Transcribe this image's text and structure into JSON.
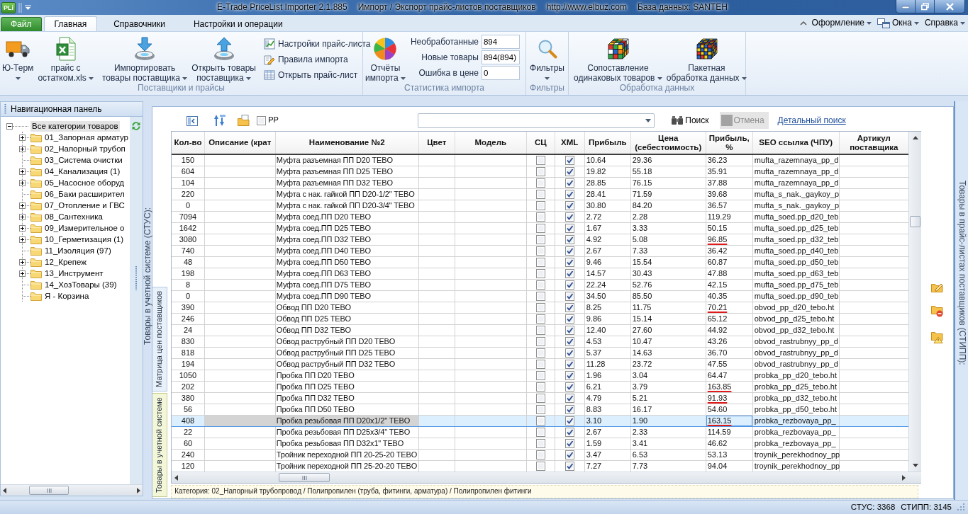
{
  "window": {
    "app_icon_label": "PLi",
    "title_parts": [
      "E-Trade PriceList Importer 2.1.885",
      "Импорт / Экспорт прайс-листов поставщиков",
      "http://www.elbuz.com",
      "База данных: SANTEH"
    ]
  },
  "ribbon": {
    "tabs": [
      {
        "label": "Файл",
        "kind": "file",
        "selected": false
      },
      {
        "label": "Главная",
        "kind": "tab",
        "selected": true
      },
      {
        "label": "Справочники",
        "kind": "tab",
        "selected": false
      },
      {
        "label": "Настройки и операции",
        "kind": "tab",
        "selected": false
      }
    ],
    "menus": [
      {
        "label": "Оформление"
      },
      {
        "label": "Окна"
      },
      {
        "label": "Справка"
      }
    ],
    "groups": [
      {
        "label": "Поставщики и прайсы",
        "items": [
          {
            "kind": "large",
            "label": "Ю-Терм",
            "dropdown": true
          },
          {
            "kind": "large",
            "label": "прайс с\nостатком.xls",
            "dropdown": true
          },
          {
            "kind": "large",
            "label": "Импортировать\nтовары поставщика",
            "dropdown": true
          },
          {
            "kind": "large",
            "label": "Открыть товары\nпоставщика",
            "dropdown": true
          },
          {
            "kind": "small_stack",
            "buttons": [
              {
                "label": "Настройки прайс-листа"
              },
              {
                "label": "Правила импорта"
              },
              {
                "label": "Открыть прайс-лист"
              }
            ]
          }
        ]
      },
      {
        "label": "Статистика импорта",
        "items": [
          {
            "kind": "large",
            "label": "Отчёты\nимпорта",
            "dropdown": true
          },
          {
            "kind": "stats",
            "fields": [
              {
                "label": "Необработанные",
                "value": "894"
              },
              {
                "label": "Новые товары",
                "value": "894(894)"
              },
              {
                "label": "Ошибка в цене",
                "value": "0"
              }
            ]
          }
        ]
      },
      {
        "label": "Фильтры",
        "items": [
          {
            "kind": "large",
            "label": "Фильтры",
            "dropdown": true
          }
        ]
      },
      {
        "label": "Обработка данных",
        "items": [
          {
            "kind": "large",
            "label": "Сопоставление\nодинаковых товаров",
            "dropdown": true
          },
          {
            "kind": "large",
            "label": "Пакетная\nобработка данных",
            "dropdown": true
          }
        ]
      }
    ]
  },
  "navigation": {
    "title": "Навигационная панель",
    "tree": {
      "label": "Все категории товаров",
      "expanded": true,
      "selected": true,
      "children": [
        {
          "label": "01_Запорная арматур",
          "expandable": true,
          "selected": false
        },
        {
          "label": "02_Напорный трубоп",
          "expandable": true,
          "selected": false
        },
        {
          "label": "03_Система очистки",
          "expandable": false,
          "selected": false
        },
        {
          "label": "04_Канализация (1)",
          "expandable": true,
          "selected": false
        },
        {
          "label": "05_Насосное оборуд",
          "expandable": true,
          "selected": false
        },
        {
          "label": "06_Баки расширител",
          "expandable": false,
          "selected": false
        },
        {
          "label": "07_Отопление и ГВС",
          "expandable": true,
          "selected": false
        },
        {
          "label": "08_Сантехника",
          "expandable": true,
          "selected": false
        },
        {
          "label": "09_Измерительное о",
          "expandable": true,
          "selected": false
        },
        {
          "label": "10_Герметизация (1)",
          "expandable": true,
          "selected": false
        },
        {
          "label": "11_Изоляция (97)",
          "expandable": false,
          "selected": false
        },
        {
          "label": "12_Крепеж",
          "expandable": true,
          "selected": false
        },
        {
          "label": "13_Инструмент",
          "expandable": true,
          "selected": false
        },
        {
          "label": "14_ХозТовары (39)",
          "expandable": false,
          "selected": false
        },
        {
          "label": "Я - Корзина",
          "expandable": false,
          "selected": false
        }
      ]
    }
  },
  "side_tab_left": "Товары в учетной системе (СТУС):",
  "panel_tabs": [
    {
      "label": "Матрица цен поставщиков",
      "selected": false
    },
    {
      "label": "Товары в учетной системе",
      "selected": true
    }
  ],
  "toolbar": {
    "pp_checkbox": {
      "label": "PP",
      "checked": false
    },
    "search_button": {
      "label": "Поиск",
      "disabled": false
    },
    "cancel_button": {
      "label": "Отмена",
      "disabled": true
    },
    "advanced_search_link": "Детальный поиск"
  },
  "table": {
    "columns": [
      {
        "label": "Кол-во"
      },
      {
        "label": "Описание (крат"
      },
      {
        "label": "Наименование №2"
      },
      {
        "label": "Цвет"
      },
      {
        "label": "Модель"
      },
      {
        "label": "СЦ"
      },
      {
        "label": "XML"
      },
      {
        "label": "Прибыль"
      },
      {
        "label": "Цена (себестоимость)"
      },
      {
        "label": "Прибыль, %"
      },
      {
        "label": "SEO ссылка (ЧПУ)"
      },
      {
        "label": "Артикул поставщика"
      }
    ],
    "rows": [
      {
        "quantity": "150",
        "name": "Муфта разъемная ПП D20 TEBO",
        "sc_checked": false,
        "xml_checked": true,
        "profit": "10.64",
        "cost": "29.36",
        "profit_percent": "36.23",
        "seo_link": "mufta_razemnaya_pp_d",
        "selected": false,
        "pen_mark": false
      },
      {
        "quantity": "604",
        "name": "Муфта разъемная ПП D25 TEBO",
        "sc_checked": false,
        "xml_checked": true,
        "profit": "19.82",
        "cost": "55.18",
        "profit_percent": "35.91",
        "seo_link": "mufta_razemnaya_pp_d",
        "selected": false,
        "pen_mark": false
      },
      {
        "quantity": "104",
        "name": "Муфта разъемная ПП D32 TEBO",
        "sc_checked": false,
        "xml_checked": true,
        "profit": "28.85",
        "cost": "76.15",
        "profit_percent": "37.88",
        "seo_link": "mufta_razemnaya_pp_d",
        "selected": false,
        "pen_mark": false
      },
      {
        "quantity": "220",
        "name": "Муфта с нак. гайкой ПП D20-1/2\" TEBO",
        "sc_checked": false,
        "xml_checked": true,
        "profit": "28.41",
        "cost": "71.59",
        "profit_percent": "39.68",
        "seo_link": "mufta_s_nak._gaykoy_p",
        "selected": false,
        "pen_mark": false
      },
      {
        "quantity": "0",
        "name": "Муфта с нак. гайкой ПП D20-3/4\" TEBO",
        "sc_checked": false,
        "xml_checked": true,
        "profit": "30.80",
        "cost": "84.20",
        "profit_percent": "36.57",
        "seo_link": "mufta_s_nak._gaykoy_p",
        "selected": false,
        "pen_mark": false
      },
      {
        "quantity": "7094",
        "name": "Муфта соед.ПП D20 TEBO",
        "sc_checked": false,
        "xml_checked": true,
        "profit": "2.72",
        "cost": "2.28",
        "profit_percent": "119.29",
        "seo_link": "mufta_soed.pp_d20_teb",
        "selected": false,
        "pen_mark": false
      },
      {
        "quantity": "1642",
        "name": "Муфта соед.ПП D25 TEBO",
        "sc_checked": false,
        "xml_checked": true,
        "profit": "1.67",
        "cost": "3.33",
        "profit_percent": "50.15",
        "seo_link": "mufta_soed.pp_d25_teb",
        "selected": false,
        "pen_mark": false
      },
      {
        "quantity": "3080",
        "name": "Муфта соед.ПП D32 TEBO",
        "sc_checked": false,
        "xml_checked": true,
        "profit": "4.92",
        "cost": "5.08",
        "profit_percent": "96.85",
        "seo_link": "mufta_soed.pp_d32_teb",
        "selected": false,
        "pen_mark": true
      },
      {
        "quantity": "740",
        "name": "Муфта соед.ПП D40 TEBO",
        "sc_checked": false,
        "xml_checked": true,
        "profit": "2.67",
        "cost": "7.33",
        "profit_percent": "36.42",
        "seo_link": "mufta_soed.pp_d40_teb",
        "selected": false,
        "pen_mark": false
      },
      {
        "quantity": "48",
        "name": "Муфта соед.ПП D50 TEBO",
        "sc_checked": false,
        "xml_checked": true,
        "profit": "9.46",
        "cost": "15.54",
        "profit_percent": "60.87",
        "seo_link": "mufta_soed.pp_d50_teb",
        "selected": false,
        "pen_mark": false
      },
      {
        "quantity": "198",
        "name": "Муфта соед.ПП D63 TEBO",
        "sc_checked": false,
        "xml_checked": true,
        "profit": "14.57",
        "cost": "30.43",
        "profit_percent": "47.88",
        "seo_link": "mufta_soed.pp_d63_teb",
        "selected": false,
        "pen_mark": false
      },
      {
        "quantity": "8",
        "name": "Муфта соед.ПП D75 TEBO",
        "sc_checked": false,
        "xml_checked": true,
        "profit": "22.24",
        "cost": "52.76",
        "profit_percent": "42.15",
        "seo_link": "mufta_soed.pp_d75_teb",
        "selected": false,
        "pen_mark": false
      },
      {
        "quantity": "0",
        "name": "Муфта соед.ПП D90 TEBO",
        "sc_checked": false,
        "xml_checked": true,
        "profit": "34.50",
        "cost": "85.50",
        "profit_percent": "40.35",
        "seo_link": "mufta_soed.pp_d90_teb",
        "selected": false,
        "pen_mark": false
      },
      {
        "quantity": "390",
        "name": "Обвод ПП D20 TEBO",
        "sc_checked": false,
        "xml_checked": true,
        "profit": "8.25",
        "cost": "11.75",
        "profit_percent": "70.21",
        "seo_link": "obvod_pp_d20_tebo.ht",
        "selected": false,
        "pen_mark": true
      },
      {
        "quantity": "246",
        "name": "Обвод ПП D25 TEBO",
        "sc_checked": false,
        "xml_checked": true,
        "profit": "9.86",
        "cost": "15.14",
        "profit_percent": "65.12",
        "seo_link": "obvod_pp_d25_tebo.ht",
        "selected": false,
        "pen_mark": false
      },
      {
        "quantity": "24",
        "name": "Обвод ПП D32 TEBO",
        "sc_checked": false,
        "xml_checked": true,
        "profit": "12.40",
        "cost": "27.60",
        "profit_percent": "44.92",
        "seo_link": "obvod_pp_d32_tebo.ht",
        "selected": false,
        "pen_mark": false
      },
      {
        "quantity": "830",
        "name": "Обвод раструбный ПП D20 TEBO",
        "sc_checked": false,
        "xml_checked": true,
        "profit": "4.53",
        "cost": "10.47",
        "profit_percent": "43.26",
        "seo_link": "obvod_rastrubnyy_pp_d",
        "selected": false,
        "pen_mark": false
      },
      {
        "quantity": "818",
        "name": "Обвод раструбный ПП D25 TEBO",
        "sc_checked": false,
        "xml_checked": true,
        "profit": "5.37",
        "cost": "14.63",
        "profit_percent": "36.70",
        "seo_link": "obvod_rastrubnyy_pp_d",
        "selected": false,
        "pen_mark": false
      },
      {
        "quantity": "194",
        "name": "Обвод раструбный ПП D32 TEBO",
        "sc_checked": false,
        "xml_checked": true,
        "profit": "11.28",
        "cost": "23.72",
        "profit_percent": "47.55",
        "seo_link": "obvod_rastrubnyy_pp_d",
        "selected": false,
        "pen_mark": false
      },
      {
        "quantity": "1050",
        "name": "Пробка ПП D20 TEBO",
        "sc_checked": false,
        "xml_checked": true,
        "profit": "1.96",
        "cost": "3.04",
        "profit_percent": "64.47",
        "seo_link": "probka_pp_d20_tebo.ht",
        "selected": false,
        "pen_mark": false
      },
      {
        "quantity": "202",
        "name": "Пробка ПП D25 TEBO",
        "sc_checked": false,
        "xml_checked": true,
        "profit": "6.21",
        "cost": "3.79",
        "profit_percent": "163.85",
        "seo_link": "probka_pp_d25_tebo.ht",
        "selected": false,
        "pen_mark": true
      },
      {
        "quantity": "380",
        "name": "Пробка ПП D32 TEBO",
        "sc_checked": false,
        "xml_checked": true,
        "profit": "4.79",
        "cost": "5.21",
        "profit_percent": "91.93",
        "seo_link": "probka_pp_d32_tebo.ht",
        "selected": false,
        "pen_mark": true
      },
      {
        "quantity": "56",
        "name": "Пробка ПП D50 TEBO",
        "sc_checked": false,
        "xml_checked": true,
        "profit": "8.83",
        "cost": "16.17",
        "profit_percent": "54.60",
        "seo_link": "probka_pp_d50_tebo.ht",
        "selected": false,
        "pen_mark": false
      },
      {
        "quantity": "408",
        "name": "Пробка резьбовая ПП D20x1/2\" TEBO",
        "sc_checked": false,
        "xml_checked": true,
        "profit": "3.10",
        "cost": "1.90",
        "profit_percent": "163.15",
        "seo_link": "probka_rezbovaya_pp_",
        "selected": true,
        "pen_mark": true
      },
      {
        "quantity": "22",
        "name": "Пробка резьбовая ПП D25x3/4\" TEBO",
        "sc_checked": false,
        "xml_checked": true,
        "profit": "2.67",
        "cost": "2.33",
        "profit_percent": "114.59",
        "seo_link": "probka_rezbovaya_pp_",
        "selected": false,
        "pen_mark": false
      },
      {
        "quantity": "60",
        "name": "Пробка резьбовая ПП D32x1\" TEBO",
        "sc_checked": false,
        "xml_checked": true,
        "profit": "1.59",
        "cost": "3.41",
        "profit_percent": "46.62",
        "seo_link": "probka_rezbovaya_pp_",
        "selected": false,
        "pen_mark": false
      },
      {
        "quantity": "240",
        "name": "Тройник переходной ПП 20-25-20 TEBO",
        "sc_checked": false,
        "xml_checked": true,
        "profit": "3.47",
        "cost": "6.53",
        "profit_percent": "53.13",
        "seo_link": "troynik_perekhodnoy_pp",
        "selected": false,
        "pen_mark": false
      },
      {
        "quantity": "120",
        "name": "Тройник переходной ПП 25-20-20 TEBO",
        "sc_checked": false,
        "xml_checked": true,
        "profit": "7.27",
        "cost": "7.73",
        "profit_percent": "94.04",
        "seo_link": "troynik_perekhodnoy_pp",
        "selected": false,
        "pen_mark": false
      }
    ]
  },
  "category_path": "Категория: 02_Напорный трубопровод / Полипропилен (труба, фитинги, арматура) / Полипропилен фитинги",
  "side_tab_right": "Товары в прайс-листах поставщиков (СТИПП):",
  "status_bar": {
    "items": [
      "СТУС: 3368",
      "СТИПП: 3145"
    ]
  }
}
